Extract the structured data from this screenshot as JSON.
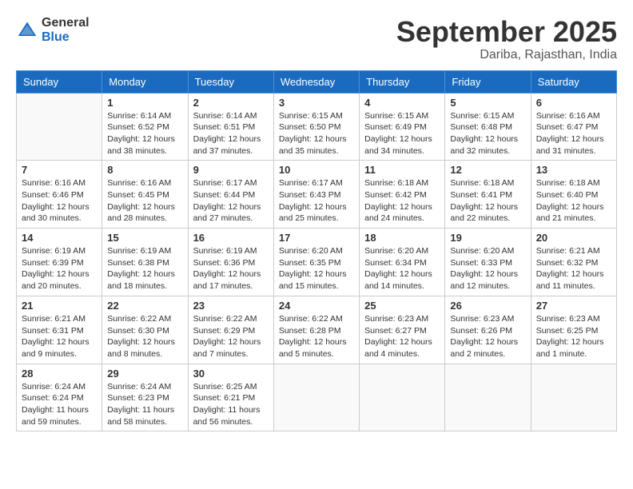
{
  "logo": {
    "general": "General",
    "blue": "Blue"
  },
  "title": "September 2025",
  "location": "Dariba, Rajasthan, India",
  "days_of_week": [
    "Sunday",
    "Monday",
    "Tuesday",
    "Wednesday",
    "Thursday",
    "Friday",
    "Saturday"
  ],
  "weeks": [
    [
      {
        "day": "",
        "info": ""
      },
      {
        "day": "1",
        "info": "Sunrise: 6:14 AM\nSunset: 6:52 PM\nDaylight: 12 hours and 38 minutes."
      },
      {
        "day": "2",
        "info": "Sunrise: 6:14 AM\nSunset: 6:51 PM\nDaylight: 12 hours and 37 minutes."
      },
      {
        "day": "3",
        "info": "Sunrise: 6:15 AM\nSunset: 6:50 PM\nDaylight: 12 hours and 35 minutes."
      },
      {
        "day": "4",
        "info": "Sunrise: 6:15 AM\nSunset: 6:49 PM\nDaylight: 12 hours and 34 minutes."
      },
      {
        "day": "5",
        "info": "Sunrise: 6:15 AM\nSunset: 6:48 PM\nDaylight: 12 hours and 32 minutes."
      },
      {
        "day": "6",
        "info": "Sunrise: 6:16 AM\nSunset: 6:47 PM\nDaylight: 12 hours and 31 minutes."
      }
    ],
    [
      {
        "day": "7",
        "info": "Sunrise: 6:16 AM\nSunset: 6:46 PM\nDaylight: 12 hours and 30 minutes."
      },
      {
        "day": "8",
        "info": "Sunrise: 6:16 AM\nSunset: 6:45 PM\nDaylight: 12 hours and 28 minutes."
      },
      {
        "day": "9",
        "info": "Sunrise: 6:17 AM\nSunset: 6:44 PM\nDaylight: 12 hours and 27 minutes."
      },
      {
        "day": "10",
        "info": "Sunrise: 6:17 AM\nSunset: 6:43 PM\nDaylight: 12 hours and 25 minutes."
      },
      {
        "day": "11",
        "info": "Sunrise: 6:18 AM\nSunset: 6:42 PM\nDaylight: 12 hours and 24 minutes."
      },
      {
        "day": "12",
        "info": "Sunrise: 6:18 AM\nSunset: 6:41 PM\nDaylight: 12 hours and 22 minutes."
      },
      {
        "day": "13",
        "info": "Sunrise: 6:18 AM\nSunset: 6:40 PM\nDaylight: 12 hours and 21 minutes."
      }
    ],
    [
      {
        "day": "14",
        "info": "Sunrise: 6:19 AM\nSunset: 6:39 PM\nDaylight: 12 hours and 20 minutes."
      },
      {
        "day": "15",
        "info": "Sunrise: 6:19 AM\nSunset: 6:38 PM\nDaylight: 12 hours and 18 minutes."
      },
      {
        "day": "16",
        "info": "Sunrise: 6:19 AM\nSunset: 6:36 PM\nDaylight: 12 hours and 17 minutes."
      },
      {
        "day": "17",
        "info": "Sunrise: 6:20 AM\nSunset: 6:35 PM\nDaylight: 12 hours and 15 minutes."
      },
      {
        "day": "18",
        "info": "Sunrise: 6:20 AM\nSunset: 6:34 PM\nDaylight: 12 hours and 14 minutes."
      },
      {
        "day": "19",
        "info": "Sunrise: 6:20 AM\nSunset: 6:33 PM\nDaylight: 12 hours and 12 minutes."
      },
      {
        "day": "20",
        "info": "Sunrise: 6:21 AM\nSunset: 6:32 PM\nDaylight: 12 hours and 11 minutes."
      }
    ],
    [
      {
        "day": "21",
        "info": "Sunrise: 6:21 AM\nSunset: 6:31 PM\nDaylight: 12 hours and 9 minutes."
      },
      {
        "day": "22",
        "info": "Sunrise: 6:22 AM\nSunset: 6:30 PM\nDaylight: 12 hours and 8 minutes."
      },
      {
        "day": "23",
        "info": "Sunrise: 6:22 AM\nSunset: 6:29 PM\nDaylight: 12 hours and 7 minutes."
      },
      {
        "day": "24",
        "info": "Sunrise: 6:22 AM\nSunset: 6:28 PM\nDaylight: 12 hours and 5 minutes."
      },
      {
        "day": "25",
        "info": "Sunrise: 6:23 AM\nSunset: 6:27 PM\nDaylight: 12 hours and 4 minutes."
      },
      {
        "day": "26",
        "info": "Sunrise: 6:23 AM\nSunset: 6:26 PM\nDaylight: 12 hours and 2 minutes."
      },
      {
        "day": "27",
        "info": "Sunrise: 6:23 AM\nSunset: 6:25 PM\nDaylight: 12 hours and 1 minute."
      }
    ],
    [
      {
        "day": "28",
        "info": "Sunrise: 6:24 AM\nSunset: 6:24 PM\nDaylight: 11 hours and 59 minutes."
      },
      {
        "day": "29",
        "info": "Sunrise: 6:24 AM\nSunset: 6:23 PM\nDaylight: 11 hours and 58 minutes."
      },
      {
        "day": "30",
        "info": "Sunrise: 6:25 AM\nSunset: 6:21 PM\nDaylight: 11 hours and 56 minutes."
      },
      {
        "day": "",
        "info": ""
      },
      {
        "day": "",
        "info": ""
      },
      {
        "day": "",
        "info": ""
      },
      {
        "day": "",
        "info": ""
      }
    ]
  ]
}
